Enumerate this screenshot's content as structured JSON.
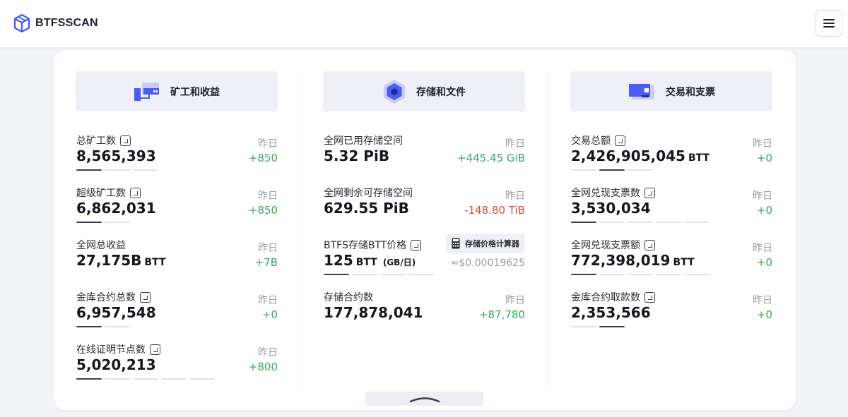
{
  "brand": {
    "name": "BTFSSCAN"
  },
  "columns": [
    {
      "title": "矿工和收益",
      "icon": "miner-icon",
      "stats": [
        {
          "label": "总矿工数",
          "info": true,
          "value": "8,565,393",
          "unit": "",
          "yday_label": "昨日",
          "delta": "+850",
          "delta_type": "pos",
          "pager_count": 3,
          "pager_active": 0
        },
        {
          "label": "超级矿工数",
          "info": true,
          "value": "6,862,031",
          "unit": "",
          "yday_label": "昨日",
          "delta": "+850",
          "delta_type": "pos",
          "pager_count": 2,
          "pager_active": 0
        },
        {
          "label": "全网总收益",
          "info": false,
          "value": "27,175B",
          "unit": "BTT",
          "yday_label": "昨日",
          "delta": "+7B",
          "delta_type": "pos",
          "pager_count": 0,
          "pager_active": -1
        },
        {
          "label": "金库合约总数",
          "info": true,
          "value": "6,957,548",
          "unit": "",
          "yday_label": "昨日",
          "delta": "+0",
          "delta_type": "pos",
          "pager_count": 2,
          "pager_active": 0
        },
        {
          "label": "在线证明节点数",
          "info": true,
          "value": "5,020,213",
          "unit": "",
          "yday_label": "昨日",
          "delta": "+800",
          "delta_type": "pos",
          "pager_count": 5,
          "pager_active": 0
        }
      ]
    },
    {
      "title": "存储和文件",
      "icon": "storage-icon",
      "stats": [
        {
          "label": "全网已用存储空间",
          "info": false,
          "value": "5.32 PiB",
          "unit": "",
          "yday_label": "昨日",
          "delta": "+445.45 GiB",
          "delta_type": "pos",
          "pager_count": 0,
          "pager_active": -1
        },
        {
          "label": "全网剩余可存储空间",
          "info": false,
          "value": "629.55 PiB",
          "unit": "",
          "yday_label": "昨日",
          "delta": "-148.80 TiB",
          "delta_type": "neg",
          "pager_count": 0,
          "pager_active": -1
        },
        {
          "label": "BTFS存储BTT价格",
          "info": true,
          "value": "125",
          "unit": "BTT",
          "unit_small": "(GB/日)",
          "calc_button": "存储价格计算器",
          "sub_price": "≈$0.00019625",
          "pager_count": 4,
          "pager_active": 0
        },
        {
          "label": "存储合约数",
          "info": false,
          "value": "177,878,041",
          "unit": "",
          "yday_label": "昨日",
          "delta": "+87,780",
          "delta_type": "pos",
          "pager_count": 0,
          "pager_active": -1
        }
      ]
    },
    {
      "title": "交易和支票",
      "icon": "exchange-icon",
      "stats": [
        {
          "label": "交易总额",
          "info": true,
          "value": "2,426,905,045",
          "unit": "BTT",
          "yday_label": "昨日",
          "delta": "+0",
          "delta_type": "pos",
          "pager_count": 3,
          "pager_active": 1
        },
        {
          "label": "全网兑现支票数",
          "info": true,
          "value": "3,530,034",
          "unit": "",
          "yday_label": "昨日",
          "delta": "+0",
          "delta_type": "pos",
          "pager_count": 5,
          "pager_active": 0
        },
        {
          "label": "全网兑现支票额",
          "info": true,
          "value": "772,398,019",
          "unit": "BTT",
          "yday_label": "昨日",
          "delta": "+0",
          "delta_type": "pos",
          "pager_count": 5,
          "pager_active": 0
        },
        {
          "label": "金库合约取款数",
          "info": true,
          "value": "2,353,566",
          "unit": "",
          "yday_label": "昨日",
          "delta": "+0",
          "delta_type": "pos",
          "pager_count": 2,
          "pager_active": 1
        }
      ]
    }
  ],
  "colors": {
    "positive": "#3fa45b",
    "negative": "#d64b3f",
    "accent": "#5a6cf0"
  }
}
